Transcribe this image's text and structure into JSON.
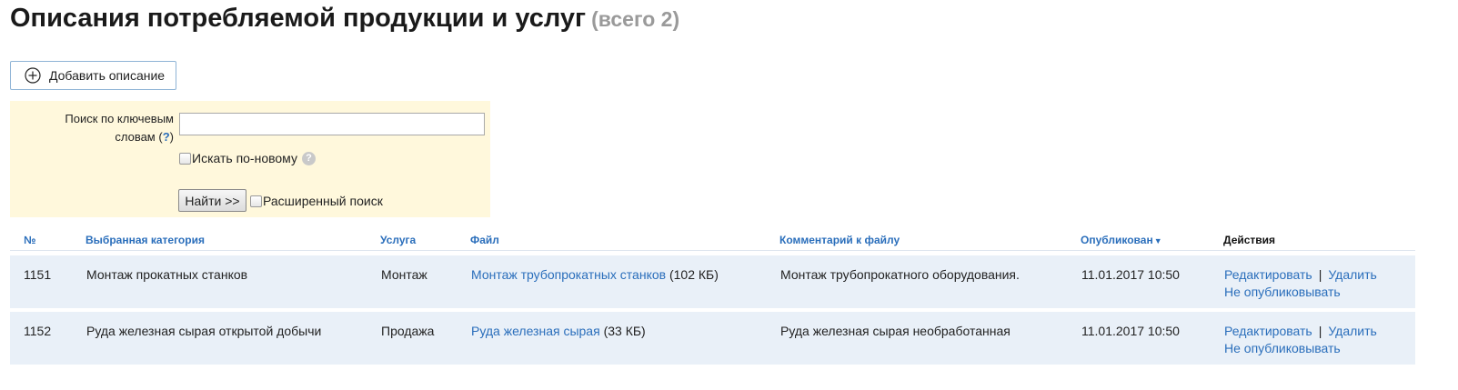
{
  "page": {
    "title": "Описания потребляемой продукции и услуг",
    "count_label": "(всего 2)"
  },
  "toolbar": {
    "add_label": "Добавить описание"
  },
  "search": {
    "keyword_label_line1": "Поиск по ключевым",
    "keyword_label_line2": "словам (",
    "help_link": "?",
    "keyword_label_close": ")",
    "keyword_value": "",
    "new_search_label": "Искать по-новому",
    "new_search_checked": false,
    "find_button": "Найти >>",
    "advanced_label": "Расширенный поиск",
    "advanced_checked": false
  },
  "table": {
    "headers": {
      "num": "№",
      "category": "Выбранная категория",
      "service": "Услуга",
      "file": "Файл",
      "comment": "Комментарий к файлу",
      "published": "Опубликован",
      "actions": "Действия"
    },
    "sort_indicator": "▼",
    "rows": [
      {
        "num": "1151",
        "category": "Монтаж прокатных станков",
        "service": "Монтаж",
        "file_name": "Монтаж трубопрокатных станков",
        "file_size": " (102 КБ)",
        "comment": "Монтаж трубопрокатного оборудования.",
        "published": "11.01.2017 10:50",
        "edit": "Редактировать",
        "separator": "|",
        "delete": "Удалить",
        "unpublish": "Не опубликовывать"
      },
      {
        "num": "1152",
        "category": "Руда железная сырая открытой добычи",
        "service": "Продажа",
        "file_name": "Руда железная сырая",
        "file_size": " (33 КБ)",
        "comment": "Руда железная сырая необработанная",
        "published": "11.01.2017 10:50",
        "edit": "Редактировать",
        "separator": "|",
        "delete": "Удалить",
        "unpublish": "Не опубликовывать"
      }
    ]
  },
  "colors": {
    "link": "#2a6ebb",
    "search_panel_bg": "#fff8dc",
    "row_bg": "#e9f0f8",
    "count_gray": "#9a9a9a"
  },
  "icons": {
    "add": "plus-circle-icon",
    "help": "question-circle-icon",
    "sort": "sort-desc-icon"
  }
}
